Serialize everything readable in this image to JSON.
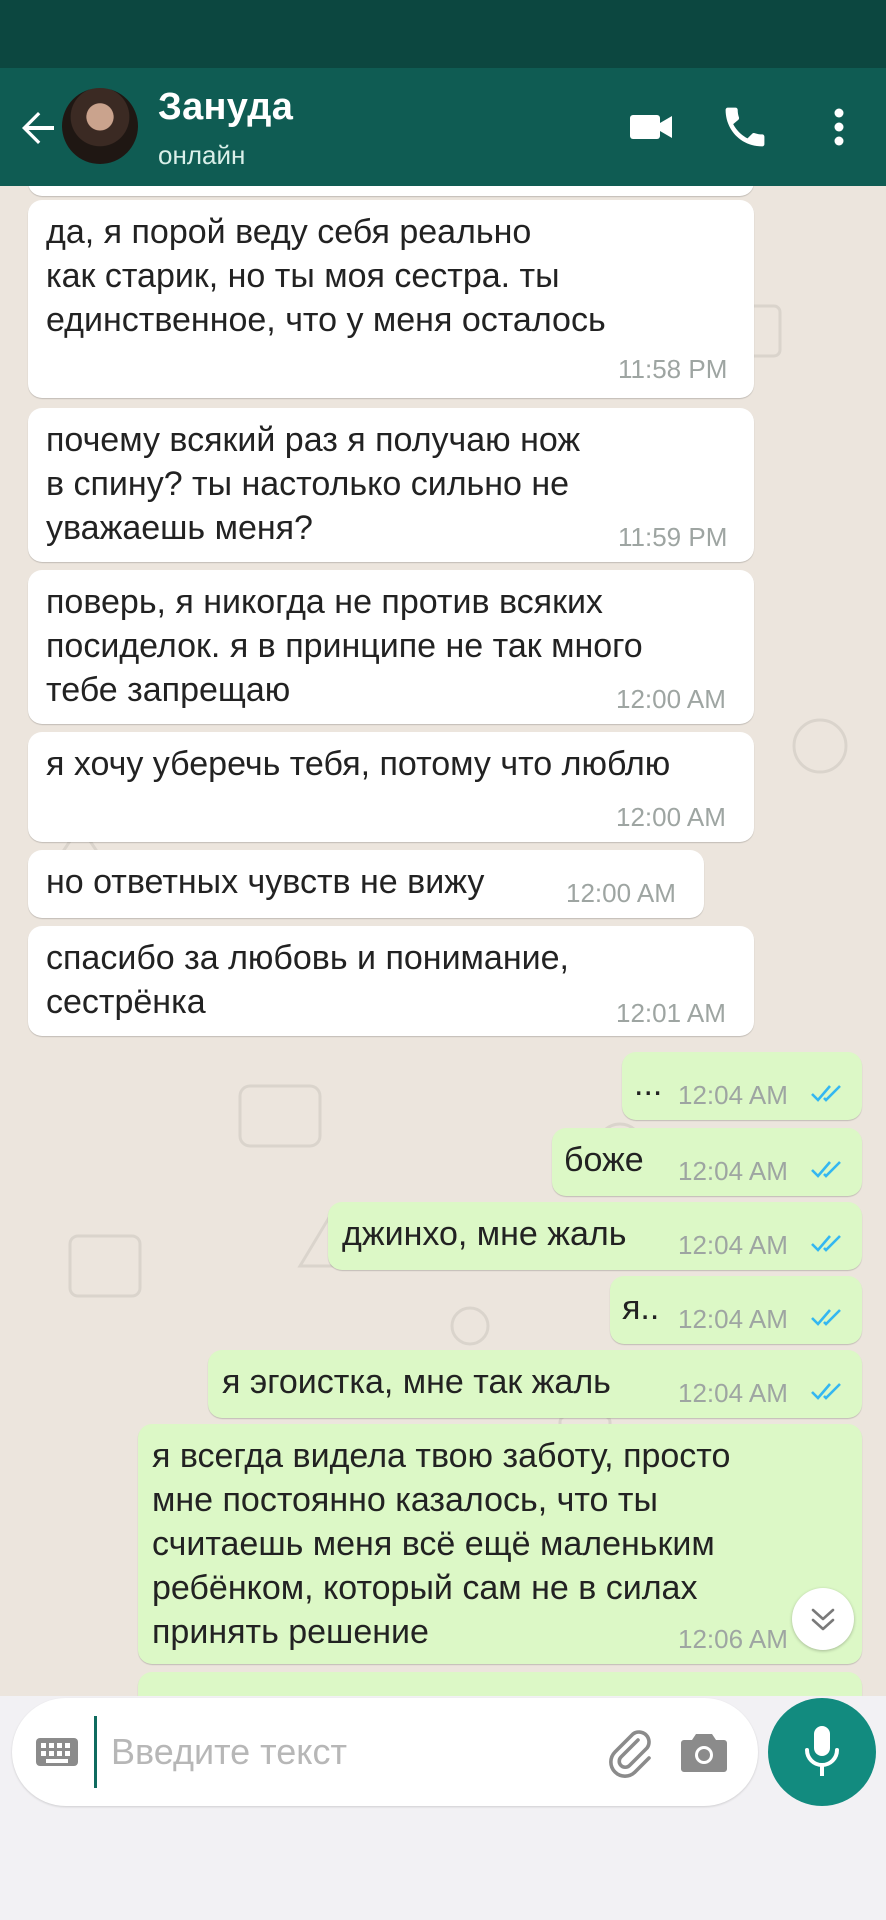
{
  "header": {
    "contact_name": "Зануда",
    "status": "онлайн",
    "back_icon": "arrow-left-icon",
    "actions": [
      "video-call-icon",
      "voice-call-icon",
      "more-vertical-icon"
    ]
  },
  "colors": {
    "statusbar": "#0c4740",
    "appbar": "#0f5c53",
    "incoming": "#ffffff",
    "outgoing": "#dcf8c6",
    "read_ticks": "#34b7f1",
    "mic_button": "#128b7f"
  },
  "messages": [
    {
      "text": "да, я порой веду себя реально\nкак старик, но ты моя сестра. ты\nединственное, что у меня осталось",
      "time": "11:58 PM"
    },
    {
      "text": "почему всякий раз я получаю нож\nв спину? ты настолько сильно не\nуважаешь меня?",
      "time": "11:59 PM"
    },
    {
      "text": "поверь, я никогда не против всяких\nпосиделок. я в принципе не так много\nтебе запрещаю",
      "time": "12:00 AM"
    },
    {
      "text": "я хочу уберечь тебя, потому что люблю",
      "time": "12:00 AM"
    },
    {
      "text": "но ответных чувств не вижу",
      "time": "12:00 AM"
    },
    {
      "text": "спасибо за любовь и понимание,\nсестрёнка",
      "time": "12:01 AM"
    },
    {
      "text": "...",
      "time": "12:04 AM"
    },
    {
      "text": "боже",
      "time": "12:04 AM"
    },
    {
      "text": "джинхо, мне жаль",
      "time": "12:04 AM"
    },
    {
      "text": "я..",
      "time": "12:04 AM"
    },
    {
      "text": "я эгоистка, мне так жаль",
      "time": "12:04 AM"
    },
    {
      "text": "я всегда видела твою заботу, просто\nмне постоянно казалось, что ты\nсчитаешь меня всё ещё маленьким\nребёнком, который сам не в силах\nпринять решение",
      "time": "12:06 AM"
    }
  ],
  "composer": {
    "placeholder": "Введите текст",
    "keyboard_icon": "keyboard-icon",
    "attach_icon": "paperclip-icon",
    "camera_icon": "camera-icon",
    "mic_icon": "microphone-icon"
  }
}
